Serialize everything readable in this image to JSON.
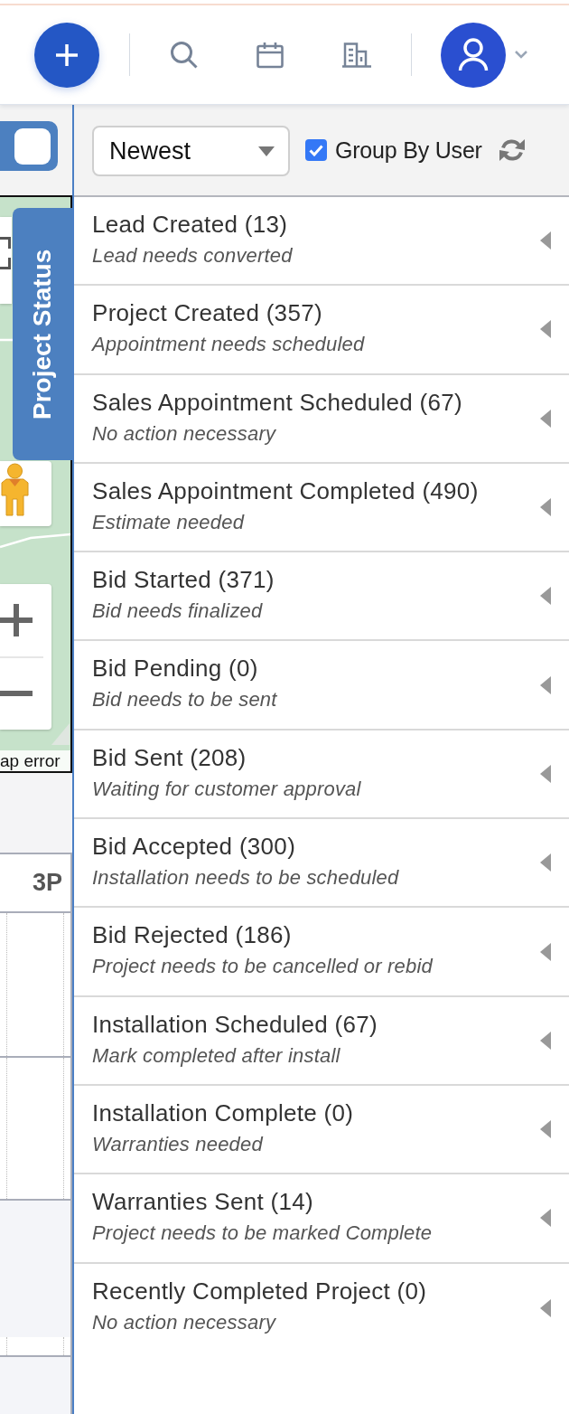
{
  "map_panel": {
    "toggle": {
      "on": true
    },
    "side_tab": "Project Status",
    "map_error": "ap error"
  },
  "calendar": {
    "column_header": "3P"
  },
  "status_panel": {
    "sort": {
      "value": "Newest"
    },
    "group_by_user": {
      "label": "Group By User",
      "checked": true
    },
    "statuses": [
      {
        "title": "Lead Created (13)",
        "note": "Lead needs converted",
        "expanded": false
      },
      {
        "title": "Project Created (357)",
        "note": "Appointment needs scheduled",
        "expanded": false
      },
      {
        "title": "Sales Appointment Scheduled (67)",
        "note": "No action necessary",
        "expanded": false
      },
      {
        "title": "Sales Appointment Completed (490)",
        "note": "Estimate needed",
        "expanded": false
      },
      {
        "title": "Bid Started (371)",
        "note": "Bid needs finalized",
        "expanded": false
      },
      {
        "title": "Bid Pending (0)",
        "note": "Bid needs to be sent",
        "expanded": false
      },
      {
        "title": "Bid Sent (208)",
        "note": "Waiting for customer approval",
        "expanded": false
      },
      {
        "title": "Bid Accepted (300)",
        "note": "Installation needs to be scheduled",
        "expanded": false
      },
      {
        "title": "Bid Rejected (186)",
        "note": "Project needs to be cancelled or rebid",
        "expanded": false
      },
      {
        "title": "Installation Scheduled (67)",
        "note": "Mark completed after install",
        "expanded": false
      },
      {
        "title": "Installation Complete (0)",
        "note": "Warranties needed",
        "expanded": false
      },
      {
        "title": "Warranties Sent (14)",
        "note": "Project needs to be marked Complete",
        "expanded": false
      },
      {
        "title": "Recently Completed Project (0)",
        "note": "No action necessary",
        "expanded": false
      }
    ]
  }
}
